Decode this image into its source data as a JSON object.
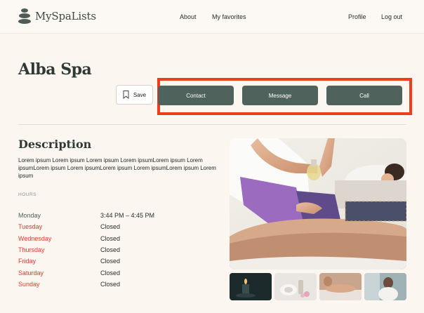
{
  "brand": {
    "name": "MySpaLists"
  },
  "nav": {
    "about": "About",
    "favorites": "My favorites",
    "profile": "Profile",
    "logout": "Log out"
  },
  "spa": {
    "name": "Alba Spa"
  },
  "actions": {
    "save": "Save",
    "contact": "Contact",
    "message": "Message",
    "call": "Call"
  },
  "description": {
    "title": "Description",
    "text": "Lorem ipsum Lorem ipsum Lorem ipsum Lorem ipsumLorem ipsum Lorem ipsumLorem ipsum Lorem ipsumLorem ipsum Lorem ipsumLorem ipsum Lorem ipsum"
  },
  "hours": {
    "label": "HOURS",
    "rows": [
      {
        "day": "Monday",
        "time": "3:44 PM – 4:45 PM",
        "closed": false
      },
      {
        "day": "Tuesday",
        "time": "Closed",
        "closed": true
      },
      {
        "day": "Wednesday",
        "time": "Closed",
        "closed": true
      },
      {
        "day": "Thursday",
        "time": "Closed",
        "closed": true
      },
      {
        "day": "Friday",
        "time": "Closed",
        "closed": true
      },
      {
        "day": "Saturday",
        "time": "Closed",
        "closed": true
      },
      {
        "day": "Sunday",
        "time": "Closed",
        "closed": true
      }
    ]
  },
  "colors": {
    "accent": "#4f625c",
    "highlight": "#ee3e1e",
    "closed_day": "#e8392a",
    "open_day": "#4f625c",
    "background": "#fbf6f0"
  }
}
